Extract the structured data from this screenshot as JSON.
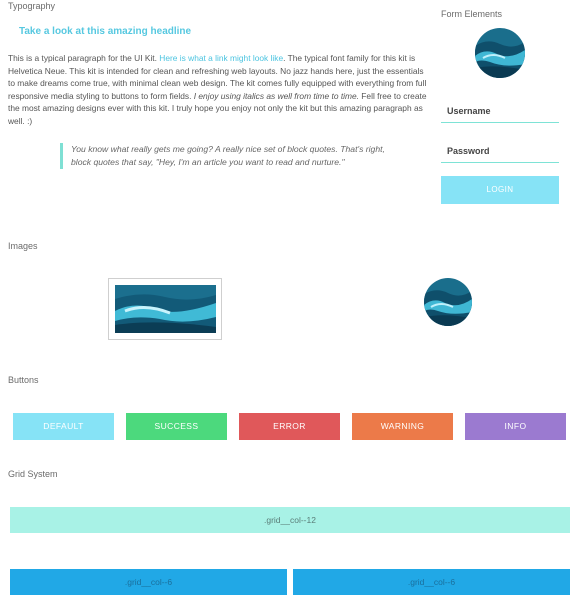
{
  "typography": {
    "section_label": "Typography",
    "headline": "Take a look at this amazing headline",
    "para_1": "This is a typical paragraph for the UI Kit. ",
    "link_text": "Here is what a link might look like",
    "para_2": ". The typical font family for this kit is Helvetica Neue. This kit is intended for clean and refreshing web layouts. No jazz hands here, just the essentials to make dreams come true, with minimal clean web design. The kit comes fully equipped with everything from full responsive media styling to buttons to form fields. ",
    "para_italic": "I enjoy using italics as well from time to time.",
    "para_3": " Fell free to create the most amazing designs ever with this kit. I truly hope you enjoy not only the kit but this amazing paragraph as well. :)",
    "blockquote": "You know what really gets me going? A really nice set of block quotes. That's right, block quotes that say, \"Hey, I'm an article you want to read and nurture.\""
  },
  "form": {
    "section_label": "Form Elements",
    "username_label": "Username",
    "password_label": "Password",
    "login_label": "LOGIN"
  },
  "images": {
    "section_label": "Images"
  },
  "buttons": {
    "section_label": "Buttons",
    "default": "DEFAULT",
    "success": "SUCCESS",
    "error": "ERROR",
    "warning": "WARNING",
    "info": "INFO"
  },
  "grid": {
    "section_label": "Grid System",
    "col12": ".grid__col--12",
    "col6_a": ".grid__col--6",
    "col6_b": ".grid__col--6"
  },
  "colors": {
    "default": "#86e3f6",
    "success": "#4cd97d",
    "error": "#e0585a",
    "warning": "#ec7a49",
    "info": "#9b7ad0",
    "accent": "#7fe0d4"
  }
}
